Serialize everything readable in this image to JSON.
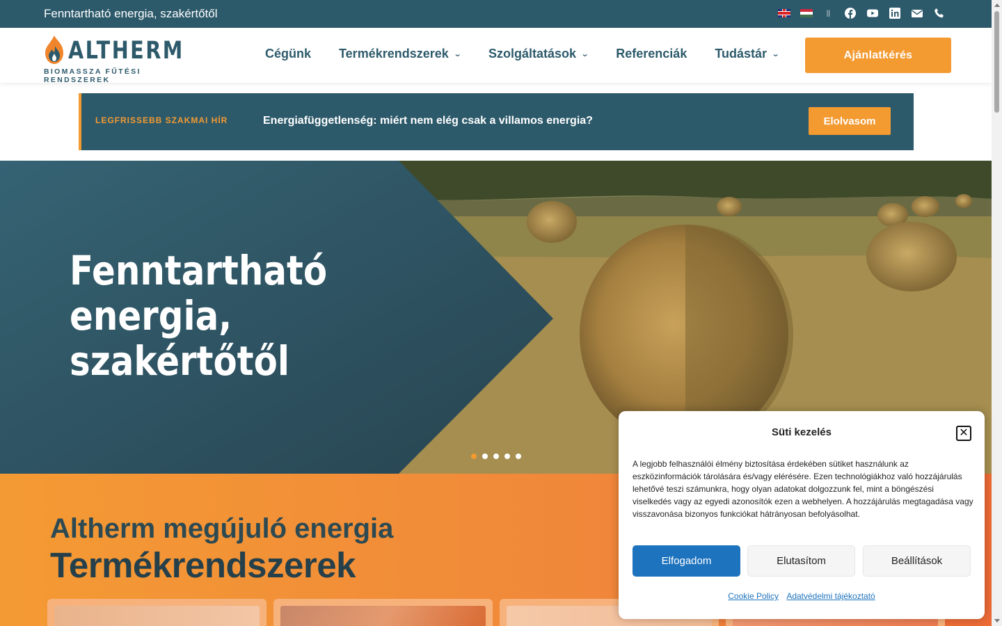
{
  "topbar": {
    "tagline": "Fenntartható energia, szakértőtől",
    "separator": "||",
    "languages": [
      "en-flag-icon",
      "hu-flag-icon"
    ],
    "socials": [
      "facebook-icon",
      "youtube-icon",
      "linkedin-icon",
      "envelope-icon",
      "phone-icon"
    ]
  },
  "header": {
    "logo": {
      "brand": "ALTHERM",
      "subtitle": "BIOMASSZA FŰTÉSI RENDSZEREK"
    },
    "nav": [
      {
        "label": "Cégünk",
        "dropdown": false
      },
      {
        "label": "Termékrendszerek",
        "dropdown": true
      },
      {
        "label": "Szolgáltatások",
        "dropdown": true
      },
      {
        "label": "Referenciák",
        "dropdown": false
      },
      {
        "label": "Tudástár",
        "dropdown": true
      }
    ],
    "chevron": "⌄",
    "cta_label": "Ajánlatkérés"
  },
  "news": {
    "label": " LEGFRISSEBB SZAKMAI HÍR",
    "headline": "Energiafüggetlenség: miért nem elég csak a villamos energia?",
    "button": "Elolvasom"
  },
  "hero": {
    "title_lines": [
      "Fenntartható",
      "energia,",
      "szakértőtől"
    ],
    "slides": 5,
    "active_slide": 1
  },
  "products": {
    "heading_small": "Altherm megújuló energia",
    "heading_big": "Termékrendszerek"
  },
  "cookie": {
    "title": "Süti kezelés",
    "close": "✕",
    "text": "A legjobb felhasználói élmény biztosítása érdekében sütiket használunk az eszközinformációk tárolására és/vagy elérésére. Ezen technológiákhoz való hozzájárulás lehetővé teszi számunkra, hogy olyan adatokat dolgozzunk fel, mint a böngészési viselkedés vagy az egyedi azonosítók ezen a webhelyen. A hozzájárulás megtagadása vagy visszavonása bizonyos funkciókat hátrányosan befolyásolhat.",
    "accept": "Elfogadom",
    "deny": "Elutasítom",
    "prefs": "Beállítások",
    "link1": "Cookie Policy",
    "link2": "Adatvédelmi tájékoztató"
  },
  "colors": {
    "teal": "#2d5a6b",
    "orange": "#f39a31",
    "accept_blue": "#1e73be"
  }
}
